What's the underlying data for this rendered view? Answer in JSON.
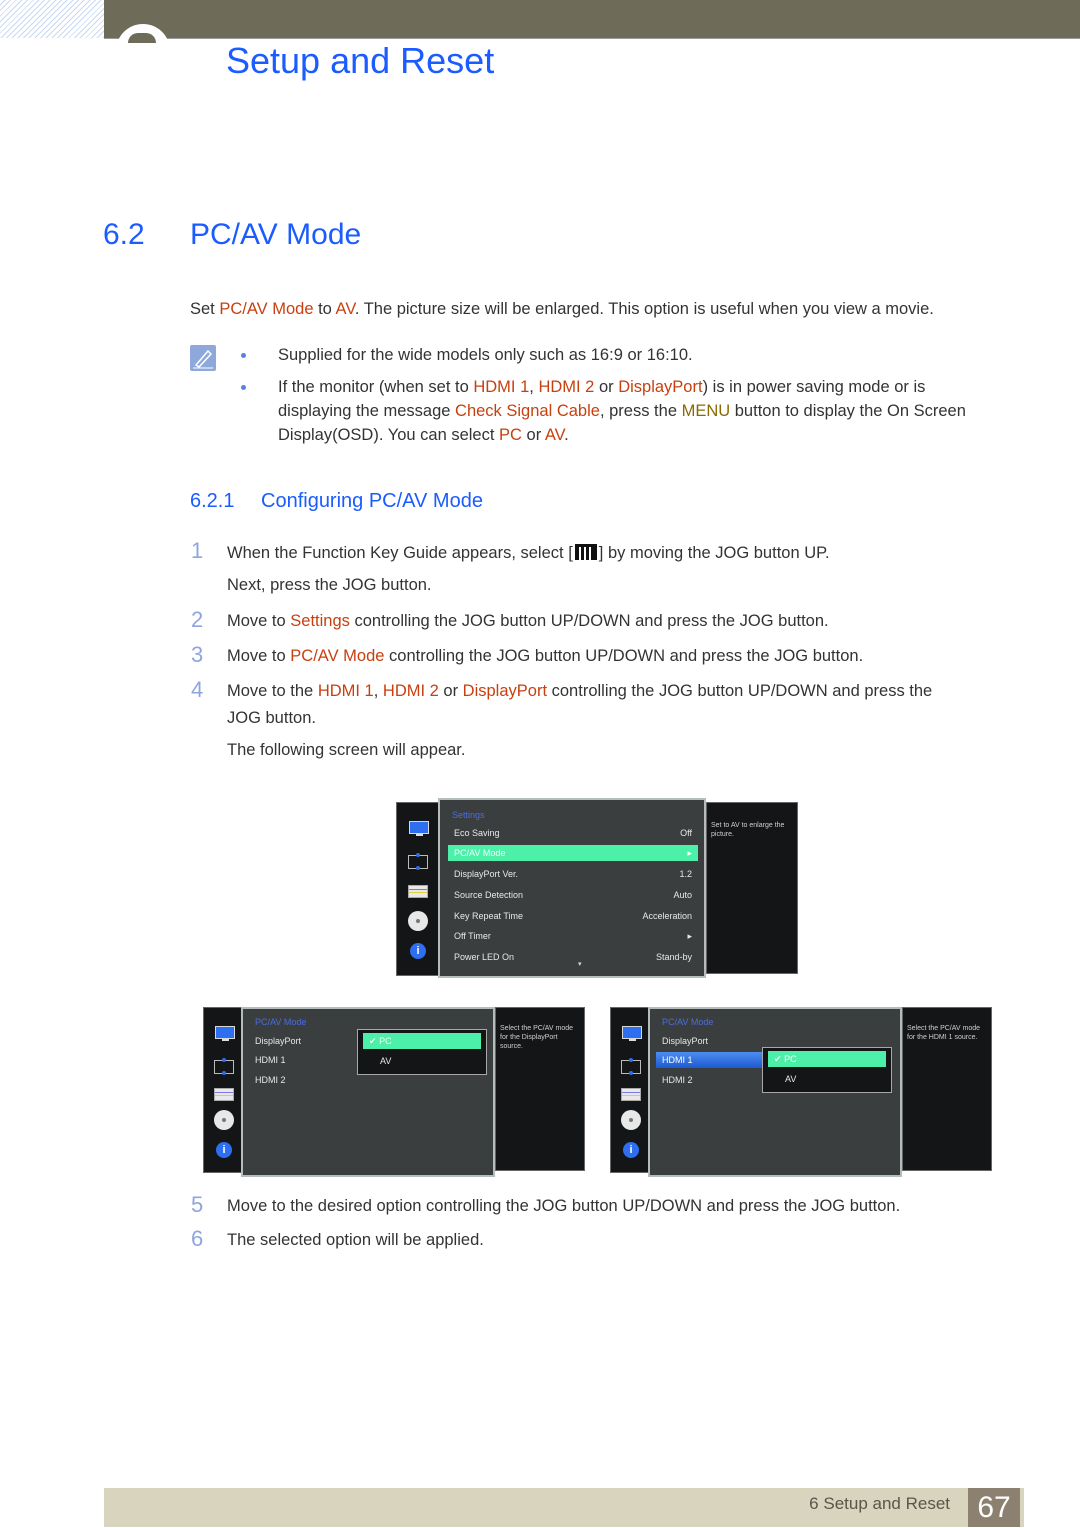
{
  "chapter": {
    "title": "Setup and Reset"
  },
  "section": {
    "number": "6.2",
    "title": "PC/AV Mode"
  },
  "intro": {
    "parts": [
      "Set ",
      "PC/AV Mode",
      " to ",
      "AV",
      ". The picture size will be enlarged. This option is useful when you view a movie."
    ]
  },
  "notes": {
    "icon": "note-pencil-icon",
    "items": [
      {
        "text": "Supplied for the wide models only such as 16:9 or 16:10."
      },
      {
        "parts": [
          "If the monitor (when set to ",
          "HDMI 1",
          ", ",
          "HDMI 2",
          " or ",
          "DisplayPort",
          ") is in power saving mode or is",
          "displaying the message ",
          "Check Signal Cable",
          ", press the ",
          "MENU",
          " button to display the On Screen",
          "Display(OSD). You can select ",
          "PC",
          " or ",
          "AV",
          "."
        ]
      }
    ]
  },
  "subsection": {
    "number": "6.2.1",
    "title": "Configuring PC/AV Mode"
  },
  "steps": [
    {
      "num": "1",
      "parts": [
        "When the Function Key Guide appears, select [",
        "",
        "] by moving the JOG button UP."
      ],
      "extra": "Next, press the JOG button.",
      "icon": "menu-key-icon"
    },
    {
      "num": "2",
      "parts": [
        "Move to ",
        "Settings",
        " controlling the JOG button UP/DOWN and press the JOG button."
      ]
    },
    {
      "num": "3",
      "parts": [
        "Move to ",
        "PC/AV Mode",
        " controlling the JOG button UP/DOWN and press the JOG button."
      ]
    },
    {
      "num": "4",
      "parts": [
        "Move to the ",
        "HDMI 1",
        ", ",
        "HDMI 2",
        " or ",
        "DisplayPort",
        " controlling the JOG button UP/DOWN and press the"
      ],
      "line2": "JOG button.",
      "extra": "The following screen will appear."
    },
    {
      "num": "5",
      "text": "Move to the desired option controlling the JOG button UP/DOWN and press the JOG button."
    },
    {
      "num": "6",
      "text": "The selected option will be applied."
    }
  ],
  "osd_settings": {
    "title": "Settings",
    "rows": [
      {
        "label": "Eco Saving",
        "value": "Off"
      },
      {
        "label": "PC/AV Mode",
        "value": "▸",
        "selected": true
      },
      {
        "label": "DisplayPort Ver.",
        "value": "1.2"
      },
      {
        "label": "Source Detection",
        "value": "Auto"
      },
      {
        "label": "Key Repeat Time",
        "value": "Acceleration"
      },
      {
        "label": "Off Timer",
        "value": "▸"
      },
      {
        "label": "Power LED On",
        "value": "Stand-by"
      }
    ],
    "more": "▾",
    "help": "Set to AV to enlarge the picture."
  },
  "osd_pcav_dp": {
    "title": "PC/AV Mode",
    "rows": [
      "DisplayPort",
      "HDMI 1",
      "HDMI 2"
    ],
    "options": [
      "PC",
      "AV"
    ],
    "checked": "✔",
    "help": "Select the PC/AV mode for the DisplayPort source."
  },
  "osd_pcav_hdmi": {
    "title": "PC/AV Mode",
    "rows": [
      "DisplayPort",
      "HDMI 1",
      "HDMI 2"
    ],
    "options": [
      "PC",
      "AV"
    ],
    "checked": "✔",
    "help": "Select the PC/AV mode for the HDMI 1 source."
  },
  "osd_icons": [
    "monitor-icon",
    "size-position-icon",
    "picture-icon",
    "gear-icon",
    "info-icon"
  ],
  "info_glyph": "i",
  "footer": {
    "label": "6 Setup and Reset",
    "page": "67"
  }
}
